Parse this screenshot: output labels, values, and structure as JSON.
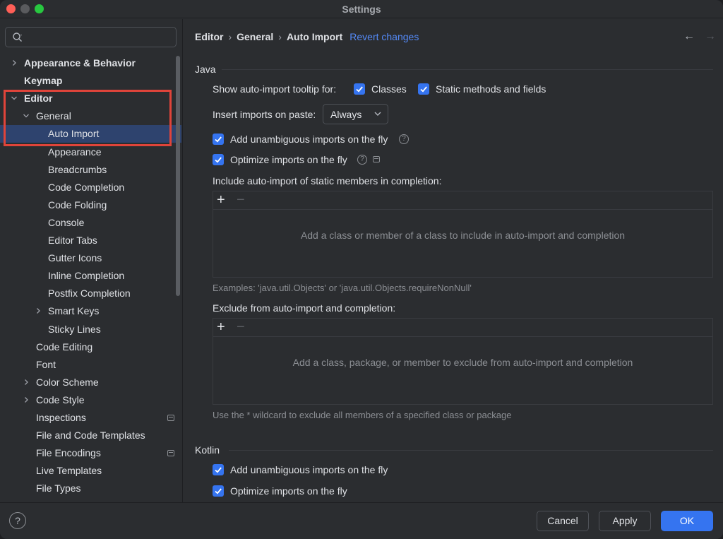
{
  "window": {
    "title": "Settings"
  },
  "search": {
    "placeholder": "",
    "value": ""
  },
  "sidebar": {
    "items": [
      {
        "label": "Appearance & Behavior",
        "level": 0,
        "bold": true,
        "chevron": "right"
      },
      {
        "label": "Keymap",
        "level": 0,
        "bold": true,
        "chevron": ""
      },
      {
        "label": "Editor",
        "level": 0,
        "bold": true,
        "chevron": "down"
      },
      {
        "label": "General",
        "level": 1,
        "bold": false,
        "chevron": "down"
      },
      {
        "label": "Auto Import",
        "level": 2,
        "bold": false,
        "chevron": "",
        "selected": true
      },
      {
        "label": "Appearance",
        "level": 2,
        "bold": false,
        "chevron": ""
      },
      {
        "label": "Breadcrumbs",
        "level": 2,
        "bold": false,
        "chevron": ""
      },
      {
        "label": "Code Completion",
        "level": 2,
        "bold": false,
        "chevron": ""
      },
      {
        "label": "Code Folding",
        "level": 2,
        "bold": false,
        "chevron": ""
      },
      {
        "label": "Console",
        "level": 2,
        "bold": false,
        "chevron": ""
      },
      {
        "label": "Editor Tabs",
        "level": 2,
        "bold": false,
        "chevron": ""
      },
      {
        "label": "Gutter Icons",
        "level": 2,
        "bold": false,
        "chevron": ""
      },
      {
        "label": "Inline Completion",
        "level": 2,
        "bold": false,
        "chevron": ""
      },
      {
        "label": "Postfix Completion",
        "level": 2,
        "bold": false,
        "chevron": ""
      },
      {
        "label": "Smart Keys",
        "level": 2,
        "bold": false,
        "chevron": "right"
      },
      {
        "label": "Sticky Lines",
        "level": 2,
        "bold": false,
        "chevron": ""
      },
      {
        "label": "Code Editing",
        "level": 1,
        "bold": false,
        "chevron": ""
      },
      {
        "label": "Font",
        "level": 1,
        "bold": false,
        "chevron": ""
      },
      {
        "label": "Color Scheme",
        "level": 1,
        "bold": false,
        "chevron": "right"
      },
      {
        "label": "Code Style",
        "level": 1,
        "bold": false,
        "chevron": "right"
      },
      {
        "label": "Inspections",
        "level": 1,
        "bold": false,
        "chevron": "",
        "badge": true
      },
      {
        "label": "File and Code Templates",
        "level": 1,
        "bold": false,
        "chevron": ""
      },
      {
        "label": "File Encodings",
        "level": 1,
        "bold": false,
        "chevron": "",
        "badge": true
      },
      {
        "label": "Live Templates",
        "level": 1,
        "bold": false,
        "chevron": ""
      },
      {
        "label": "File Types",
        "level": 1,
        "bold": false,
        "chevron": ""
      }
    ]
  },
  "breadcrumb": {
    "items": [
      "Editor",
      "General",
      "Auto Import"
    ],
    "separator": "›",
    "revert_label": "Revert changes"
  },
  "nav": {
    "back": "←",
    "forward": "→"
  },
  "java": {
    "title": "Java",
    "tooltip_label": "Show auto-import tooltip for:",
    "tooltip_classes": {
      "label": "Classes",
      "checked": true
    },
    "tooltip_static": {
      "label": "Static methods and fields",
      "checked": true
    },
    "paste_label": "Insert imports on paste:",
    "paste_value": "Always",
    "unambiguous": {
      "label": "Add unambiguous imports on the fly",
      "checked": true
    },
    "optimize": {
      "label": "Optimize imports on the fly",
      "checked": true
    },
    "static_members_title": "Include auto-import of static members in completion:",
    "static_members_empty": "Add a class or member of a class to include in auto-import and completion",
    "static_members_hint": "Examples: 'java.util.Objects' or 'java.util.Objects.requireNonNull'",
    "exclude_title": "Exclude from auto-import and completion:",
    "exclude_empty": "Add a class, package, or member to exclude from auto-import and completion",
    "exclude_hint": "Use the * wildcard to exclude all members of a specified class or package"
  },
  "toolbar_icons": {
    "add": "+",
    "remove": "−"
  },
  "kotlin": {
    "title": "Kotlin",
    "unambiguous": {
      "label": "Add unambiguous imports on the fly",
      "checked": true
    },
    "optimize": {
      "label": "Optimize imports on the fly",
      "checked": true
    }
  },
  "help_glyph": "?",
  "footer": {
    "help": "?",
    "cancel": "Cancel",
    "apply": "Apply",
    "ok": "OK"
  },
  "colors": {
    "accent": "#3574f0",
    "selection": "#2e436e",
    "highlight_box": "#e0443a",
    "link": "#548af7"
  }
}
